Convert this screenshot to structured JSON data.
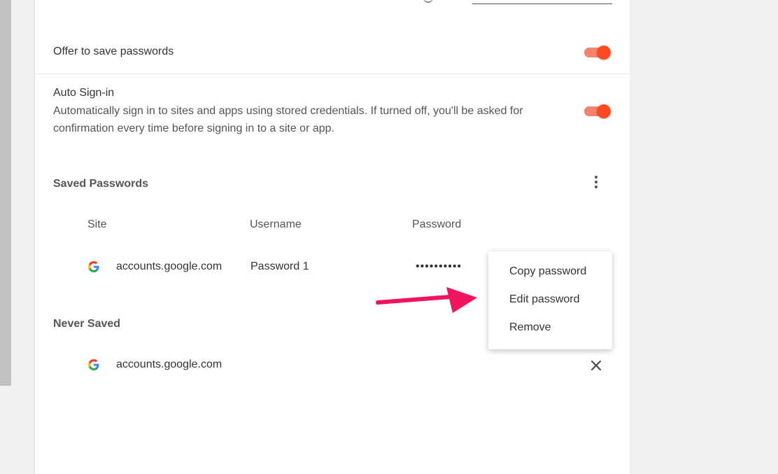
{
  "settings": {
    "offer_save": {
      "label": "Offer to save passwords",
      "enabled": true
    },
    "auto_signin": {
      "label": "Auto Sign-in",
      "description_line1": "Automatically sign in to sites and apps using stored credentials. If turned off, you'll be asked for",
      "description_line2": "confirmation every time before signing in to a site or app.",
      "enabled": true
    }
  },
  "saved_passwords": {
    "title": "Saved Passwords",
    "columns": [
      "Site",
      "Username",
      "Password"
    ],
    "rows": [
      {
        "icon": "google-icon",
        "site": "accounts.google.com",
        "username": "Password 1",
        "password": "••••••••••"
      }
    ]
  },
  "never_saved": {
    "title": "Never Saved",
    "rows": [
      {
        "icon": "google-icon",
        "site": "accounts.google.com"
      }
    ]
  },
  "context_menu": {
    "items": [
      "Copy password",
      "Edit password",
      "Remove"
    ]
  },
  "colors": {
    "toggle_knob": "#ff4a24",
    "toggle_track": "#f5826b",
    "annotation_arrow": "#f0135e"
  },
  "icons": {
    "more_actions": "kebab-menu-icon",
    "remove": "close-icon",
    "annotation": "arrow-icon"
  }
}
